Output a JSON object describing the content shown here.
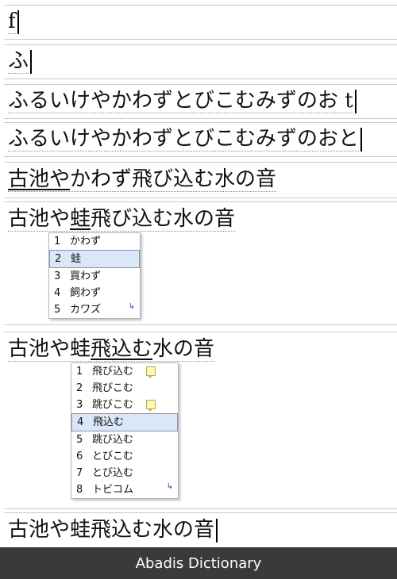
{
  "steps": {
    "s1": "f",
    "s2": "ふ",
    "s3_prefix": "ふるいけやかわずとびこむみずのお",
    "s3_suffix": "t",
    "s4": "ふるいけやかわずとびこむみずのおと",
    "s5_underlined": "古池や",
    "s5_rest": "かわず飛び込む水の音",
    "s6_a": "古池や",
    "s6_b": "蛙",
    "s6_c": "飛び込む水の音",
    "s7_a": "古池や蛙",
    "s7_b": "飛込む",
    "s7_c": "水の音",
    "s8": "古池や蛙飛込む水の音"
  },
  "candidates1": {
    "items": [
      {
        "num": "1",
        "text": "かわず"
      },
      {
        "num": "2",
        "text": "蛙"
      },
      {
        "num": "3",
        "text": "買わず"
      },
      {
        "num": "4",
        "text": "飼わず"
      },
      {
        "num": "5",
        "text": "カワズ"
      }
    ],
    "selected_index": 2
  },
  "candidates2": {
    "items": [
      {
        "num": "1",
        "text": "飛び込む"
      },
      {
        "num": "2",
        "text": "飛びこむ"
      },
      {
        "num": "3",
        "text": "跳びこむ"
      },
      {
        "num": "4",
        "text": "飛込む"
      },
      {
        "num": "5",
        "text": "跳び込む"
      },
      {
        "num": "6",
        "text": "とびこむ"
      },
      {
        "num": "7",
        "text": "とび込む"
      },
      {
        "num": "8",
        "text": "トビコム"
      }
    ],
    "selected_index": 4,
    "memo_items": [
      1,
      3
    ]
  },
  "footer": {
    "text": "Abadis Dictionary"
  },
  "colors": {
    "selection_bg": "#dbe6f6",
    "selection_border": "#7c95c5",
    "footer_bg": "#3a3a3a"
  }
}
